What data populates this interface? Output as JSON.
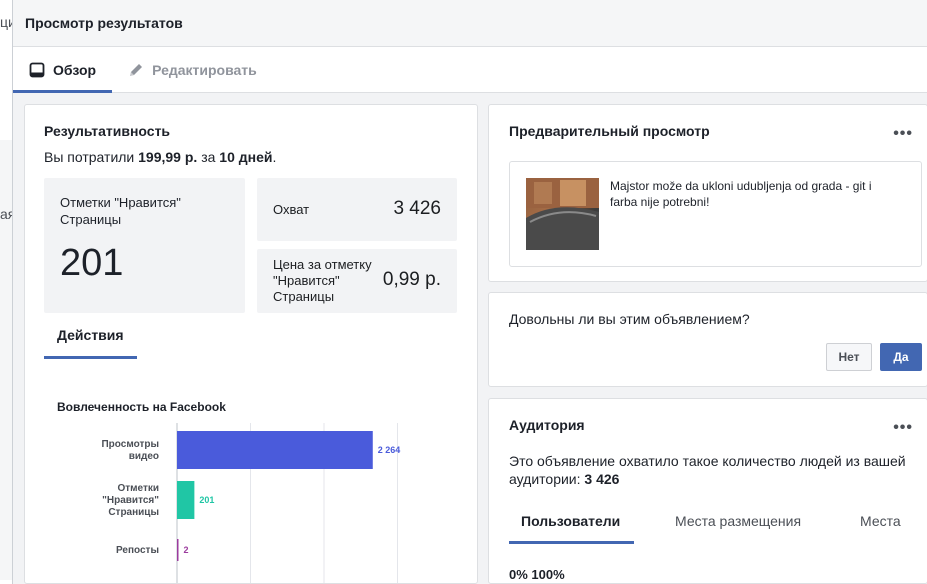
{
  "background": {
    "left_fragment_top": "ци",
    "left_fragment_mid": "ая"
  },
  "dialog": {
    "title": "Просмотр результатов",
    "tabs": [
      {
        "label": "Обзор",
        "icon": "tablet-icon",
        "active": true
      },
      {
        "label": "Редактировать",
        "icon": "pencil-icon",
        "active": false
      }
    ]
  },
  "performance": {
    "title": "Результативность",
    "spent_prefix": "Вы потратили",
    "spent_amount": "199,99 р.",
    "spent_mid": "за",
    "spent_period": "10 дней",
    "spent_suffix": ".",
    "likes_label": "Отметки \"Нравится\" Страницы",
    "likes_value": "201",
    "reach_label": "Охват",
    "reach_value": "3 426",
    "cost_label": "Цена за отметку \"Нравится\" Страницы",
    "cost_value": "0,99 р.",
    "actions_tab": "Действия"
  },
  "chart_data": {
    "type": "bar",
    "orientation": "horizontal",
    "title": "Вовлеченность на Facebook",
    "categories": [
      "Просмотры видео",
      "Отметки \"Нравится\" Страницы",
      "Репосты"
    ],
    "category_lines": [
      [
        "Просмотры",
        "видео"
      ],
      [
        "Отметки",
        "\"Нравится\"",
        "Страницы"
      ],
      [
        "Репосты"
      ]
    ],
    "values": [
      2264,
      201,
      2
    ],
    "value_labels": [
      "2 264",
      "201",
      "2"
    ],
    "colors": [
      "#4a5bdb",
      "#20c6a5",
      "#9b3b9e"
    ],
    "xlim": [
      0,
      3400
    ],
    "grid": true
  },
  "preview": {
    "title": "Предварительный просмотр",
    "menu": "•••",
    "ad_text": "Majstor može da ukloni udubljenja od grada - git i farba nije potrebni!"
  },
  "survey": {
    "question": "Довольны ли вы этим объявлением?",
    "no_label": "Нет",
    "yes_label": "Да"
  },
  "audience": {
    "title": "Аудитория",
    "menu": "•••",
    "desc_prefix": "Это объявление охватило такое количество людей из вашей аудитории:",
    "desc_value": "3 426",
    "tabs": [
      "Пользователи",
      "Места размещения",
      "Места"
    ],
    "percent_labels": "0% 100%"
  }
}
